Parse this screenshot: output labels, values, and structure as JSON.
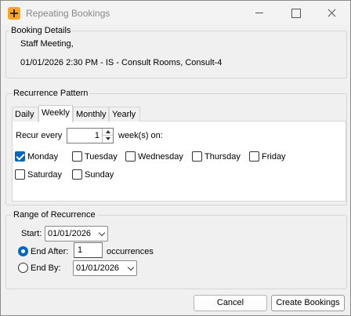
{
  "window": {
    "title": "Repeating Bookings"
  },
  "booking_details": {
    "legend": "Booking Details",
    "subject": "Staff Meeting,",
    "summary": "01/01/2026 2:30 PM - IS - Consult Rooms, Consult-4"
  },
  "recurrence": {
    "legend": "Recurrence Pattern",
    "tabs": [
      {
        "label": "Daily",
        "active": false
      },
      {
        "label": "Weekly",
        "active": true
      },
      {
        "label": "Monthly",
        "active": false
      },
      {
        "label": "Yearly",
        "active": false
      }
    ],
    "recur_every_label": "Recur every",
    "recur_every_value": "1",
    "weeks_on_label": "week(s) on:",
    "days": [
      {
        "label": "Monday",
        "checked": true
      },
      {
        "label": "Tuesday",
        "checked": false
      },
      {
        "label": "Wednesday",
        "checked": false
      },
      {
        "label": "Thursday",
        "checked": false
      },
      {
        "label": "Friday",
        "checked": false
      },
      {
        "label": "Saturday",
        "checked": false
      },
      {
        "label": "Sunday",
        "checked": false
      }
    ]
  },
  "range": {
    "legend": "Range of Recurrence",
    "start_label": "Start:",
    "start_value": "01/01/2026",
    "end_after_label": "End After:",
    "end_after_value": "1",
    "occurrences_label": "occurrences",
    "end_by_label": "End By:",
    "end_by_value": "01/01/2026",
    "selected": "end_after"
  },
  "buttons": {
    "cancel": "Cancel",
    "create": "Create Bookings"
  },
  "colors": {
    "accent": "#0067c0",
    "app_icon": "#f6a623"
  }
}
